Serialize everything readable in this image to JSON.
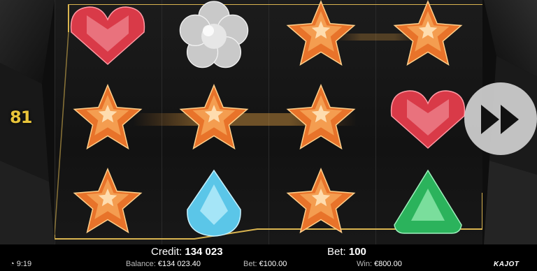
{
  "game": {
    "lines_count": "81"
  },
  "grid": {
    "columns": 4,
    "rows": 3,
    "symbols": [
      [
        "heart-red",
        "star-orange",
        "star-orange"
      ],
      [
        "flower-silver",
        "star-orange",
        "drop-blue"
      ],
      [
        "star-orange",
        "star-orange",
        "star-orange"
      ],
      [
        "star-orange",
        "heart-red",
        "triangle-green"
      ]
    ]
  },
  "top_bar": {
    "credit_label": "Credit:",
    "credit_value": "134 023",
    "bet_label": "Bet:",
    "bet_value": "100"
  },
  "status_bar": {
    "time": "9:19",
    "balance_label": "Balance:",
    "balance_value": "€134 023.40",
    "bet_label": "Bet:",
    "bet_value": "€100.00",
    "win_label": "Win:",
    "win_value": "€800.00",
    "brand": "KAJOT"
  },
  "colors": {
    "frame_gold": "#d9b450",
    "win_glow": "#ffb347"
  }
}
